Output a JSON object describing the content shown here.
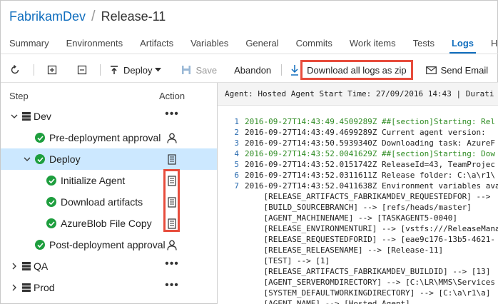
{
  "breadcrumb": {
    "project": "FabrikamDev",
    "separator": "/",
    "release": "Release-11"
  },
  "tabs": [
    {
      "label": "Summary",
      "active": false
    },
    {
      "label": "Environments",
      "active": false
    },
    {
      "label": "Artifacts",
      "active": false
    },
    {
      "label": "Variables",
      "active": false
    },
    {
      "label": "General",
      "active": false
    },
    {
      "label": "Commits",
      "active": false
    },
    {
      "label": "Work items",
      "active": false
    },
    {
      "label": "Tests",
      "active": false
    },
    {
      "label": "Logs",
      "active": true
    },
    {
      "label": "History",
      "active": false
    }
  ],
  "toolbar": {
    "deploy_label": "Deploy",
    "save_label": "Save",
    "abandon_label": "Abandon",
    "download_label": "Download all logs as zip",
    "send_email_label": "Send Email"
  },
  "tree": {
    "step_header": "Step",
    "action_header": "Action",
    "rows": [
      {
        "label": "Dev",
        "kind": "environment",
        "expanded": true,
        "action": "more"
      },
      {
        "label": "Pre-deployment approval",
        "kind": "step",
        "action": "user"
      },
      {
        "label": "Deploy",
        "kind": "phase",
        "expanded": true,
        "selected": true,
        "action": "log"
      },
      {
        "label": "Initialize Agent",
        "kind": "task",
        "action": "log"
      },
      {
        "label": "Download artifacts",
        "kind": "task",
        "action": "log"
      },
      {
        "label": "AzureBlob File Copy",
        "kind": "task",
        "action": "log"
      },
      {
        "label": "Post-deployment approval",
        "kind": "step",
        "action": "user"
      },
      {
        "label": "QA",
        "kind": "environment",
        "expanded": false,
        "action": "more"
      },
      {
        "label": "Prod",
        "kind": "environment",
        "expanded": false,
        "action": "more"
      }
    ]
  },
  "log": {
    "header": "Agent: Hosted Agent    Start Time: 27/09/2016 14:43 | Durati",
    "lines": [
      {
        "no": "1",
        "text": "2016-09-27T14:43:49.4509289Z ##[section]Starting: Rel",
        "section": true
      },
      {
        "no": "2",
        "text": "2016-09-27T14:43:49.4699289Z Current agent version:",
        "section": false
      },
      {
        "no": "3",
        "text": "2016-09-27T14:43:50.5939340Z Downloading task: AzureF",
        "section": false
      },
      {
        "no": "4",
        "text": "2016-09-27T14:43:52.0041629Z ##[section]Starting: Dow",
        "section": true
      },
      {
        "no": "5",
        "text": "2016-09-27T14:43:52.0151742Z ReleaseId=43, TeamProjec",
        "section": false
      },
      {
        "no": "6",
        "text": "2016-09-27T14:43:52.0311611Z Release folder: C:\\a\\r1\\",
        "section": false
      },
      {
        "no": "7",
        "text": "2016-09-27T14:43:52.0411638Z Environment variables ava",
        "section": false
      },
      {
        "no": "",
        "text": "    [RELEASE_ARTIFACTS_FABRIKAMDEV_REQUESTEDFOR] -->",
        "section": false
      },
      {
        "no": "",
        "text": "    [BUILD_SOURCEBRANCH] --> [refs/heads/master]",
        "section": false
      },
      {
        "no": "",
        "text": "    [AGENT_MACHINENAME] --> [TASKAGENT5-0040]",
        "section": false
      },
      {
        "no": "",
        "text": "    [RELEASE_ENVIRONMENTURI] --> [vstfs:///ReleaseMana",
        "section": false
      },
      {
        "no": "",
        "text": "    [RELEASE_REQUESTEDFORID] --> [eae9c176-13b5-4621-",
        "section": false
      },
      {
        "no": "",
        "text": "    [RELEASE_RELEASENAME] --> [Release-11]",
        "section": false
      },
      {
        "no": "",
        "text": "    [TEST] --> [1]",
        "section": false
      },
      {
        "no": "",
        "text": "    [RELEASE_ARTIFACTS_FABRIKAMDEV_BUILDID] --> [13]",
        "section": false
      },
      {
        "no": "",
        "text": "    [AGENT_SERVEROMDIRECTORY] --> [C:\\LR\\MMS\\Services",
        "section": false
      },
      {
        "no": "",
        "text": "    [SYSTEM_DEFAULTWORKINGDIRECTORY] --> [C:\\a\\r1\\a]",
        "section": false
      },
      {
        "no": "",
        "text": "    [AGENT_NAME] --> [Hosted Agent]",
        "section": false
      }
    ]
  },
  "colors": {
    "accent": "#106ebe",
    "success": "#1e9e3e",
    "highlight": "#e74c3c",
    "selected": "#cce8ff",
    "section_text": "#2e8b22"
  }
}
